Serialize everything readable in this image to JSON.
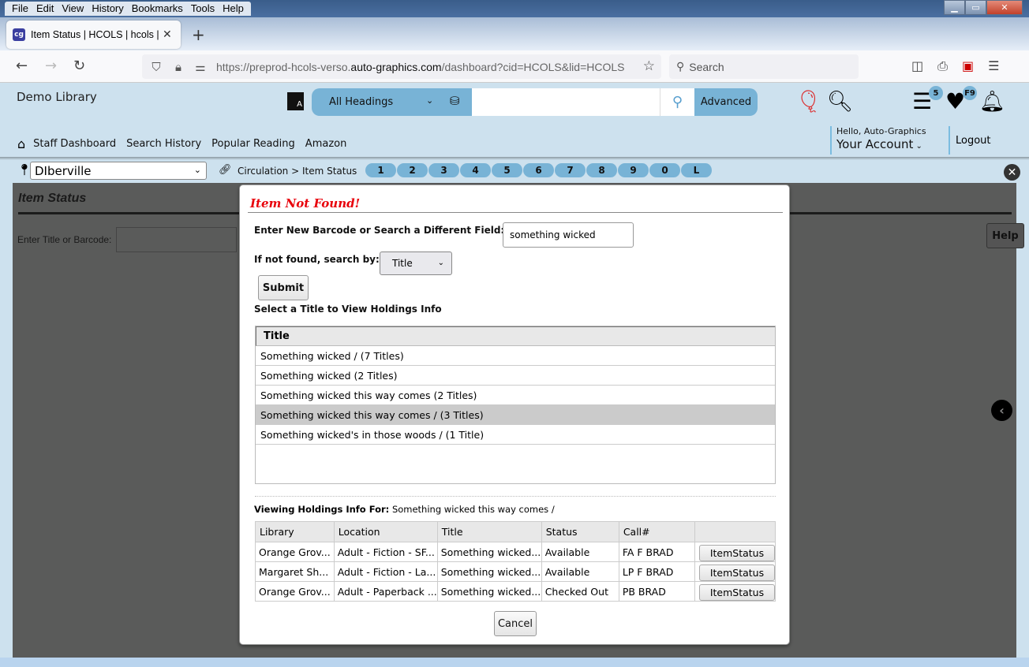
{
  "browser": {
    "menu": [
      "File",
      "Edit",
      "View",
      "History",
      "Bookmarks",
      "Tools",
      "Help"
    ],
    "tab_title": "Item Status | HCOLS | hcols | Auto-Graphics",
    "url_prefix": "https://preprod-hcols-verso.",
    "url_domain": "auto-graphics.com",
    "url_suffix": "/dashboard?cid=HCOLS&lid=HCOLS",
    "search_placeholder": "Search"
  },
  "header": {
    "library_name": "Demo Library",
    "search_scope": "All Headings",
    "search_value": "",
    "advanced_label": "Advanced",
    "list_badge": "5",
    "favorites_badge": "F9",
    "nav": [
      "Staff Dashboard",
      "Search History",
      "Popular Reading",
      "Amazon"
    ],
    "greeting": "Hello, Auto-Graphics",
    "account_label": "Your Account",
    "logout_label": "Logout"
  },
  "subbar": {
    "branch": "DIberville",
    "breadcrumb": "Circulation > Item Status",
    "letter_tabs": [
      "1",
      "2",
      "3",
      "4",
      "5",
      "6",
      "7",
      "8",
      "9",
      "0",
      "L"
    ]
  },
  "page": {
    "title": "Item Status",
    "input_label": "Enter Title or Barcode:",
    "input_value": "",
    "help_label": "Help"
  },
  "modal": {
    "title": "Item Not Found!",
    "barcode_label": "Enter New Barcode or Search a Different Field:",
    "barcode_value": "something wicked",
    "search_by_label": "If not found, search by:",
    "search_by_value": "Title",
    "submit_label": "Submit",
    "select_title_label": "Select a Title to View Holdings Info",
    "title_list_header": "Title",
    "titles": [
      "Something wicked / (7 Titles)",
      "Something wicked (2 Titles)",
      "Something wicked this way comes (2 Titles)",
      "Something wicked this way comes / (3 Titles)",
      "Something wicked's in those woods / (1 Title)"
    ],
    "selected_title_index": 3,
    "viewing_label": "Viewing Holdings Info For:",
    "viewing_value": "Something wicked this way comes /",
    "holdings_columns": [
      "Library",
      "Location",
      "Title",
      "Status",
      "Call#",
      ""
    ],
    "holdings": [
      {
        "library": "Orange Grov...",
        "location": "Adult - Fiction - SF...",
        "title": "Something wicked...",
        "status": "Available",
        "call": "FA F BRAD",
        "action": "ItemStatus"
      },
      {
        "library": "Margaret Sh...",
        "location": "Adult - Fiction - La...",
        "title": "Something wicked...",
        "status": "Available",
        "call": "LP F BRAD",
        "action": "ItemStatus"
      },
      {
        "library": "Orange Grov...",
        "location": "Adult - Paperback ...",
        "title": "Something wicked...",
        "status": "Checked Out",
        "call": "PB BRAD",
        "action": "ItemStatus"
      }
    ],
    "cancel_label": "Cancel"
  },
  "colors": {
    "header_bg": "#cde1ee",
    "accent_blue": "#78b3d6",
    "error_red": "#e8000b",
    "overlay": "#5a5b5a"
  }
}
